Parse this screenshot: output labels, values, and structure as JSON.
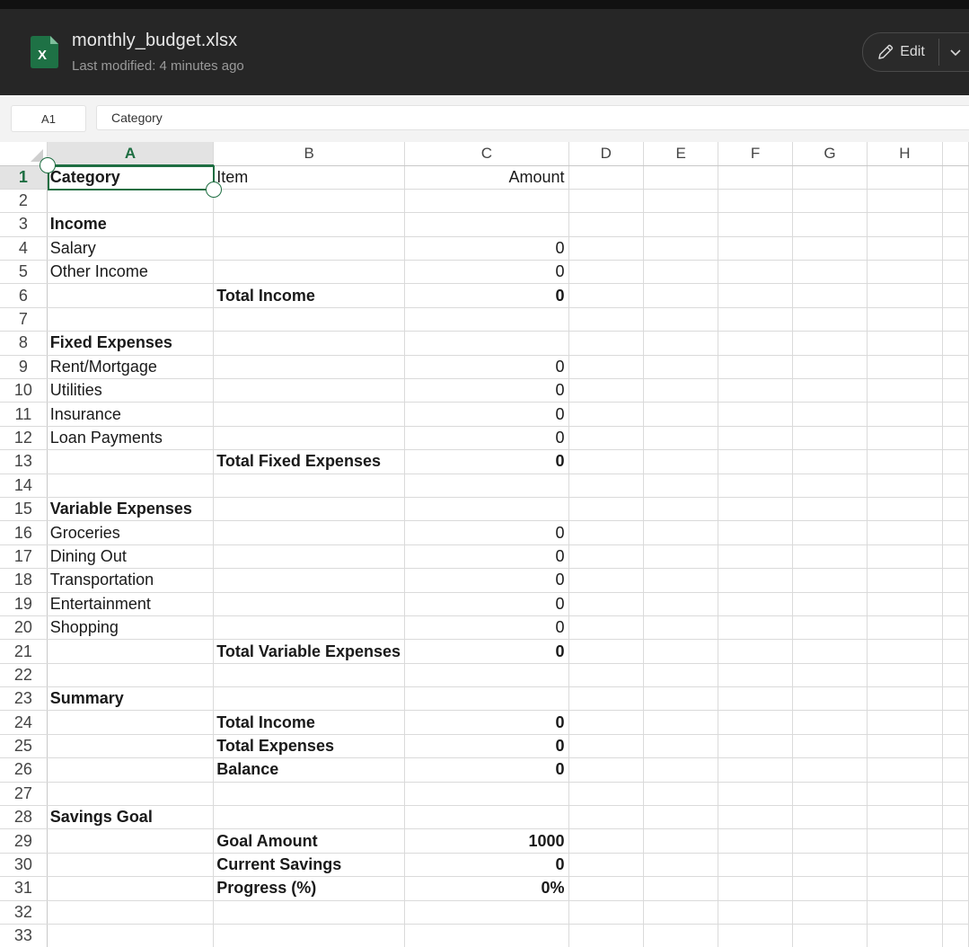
{
  "header": {
    "file_name": "monthly_budget.xlsx",
    "last_modified": "Last modified: 4 minutes ago",
    "edit_label": "Edit",
    "app_icon_letter": "X",
    "app_icon_color": "#1e7145"
  },
  "formula_bar": {
    "cell_ref": "A1",
    "content": "Category"
  },
  "columns": [
    "A",
    "B",
    "C",
    "D",
    "E",
    "F",
    "G",
    "H"
  ],
  "selected": {
    "cell": "A1",
    "color": "#1e6e42"
  },
  "rows": [
    {
      "n": "1",
      "a": "Category",
      "b": "Item",
      "c": "Amount",
      "a_bold": true
    },
    {
      "n": "2",
      "a": "",
      "b": "",
      "c": ""
    },
    {
      "n": "3",
      "a": "Income",
      "b": "",
      "c": "",
      "a_bold": true
    },
    {
      "n": "4",
      "a": "Salary",
      "b": "",
      "c": "0"
    },
    {
      "n": "5",
      "a": "Other Income",
      "b": "",
      "c": "0"
    },
    {
      "n": "6",
      "a": "",
      "b": "Total Income",
      "c": "0",
      "b_bold": true,
      "c_bold": true
    },
    {
      "n": "7",
      "a": "",
      "b": "",
      "c": ""
    },
    {
      "n": "8",
      "a": "Fixed Expenses",
      "b": "",
      "c": "",
      "a_bold": true
    },
    {
      "n": "9",
      "a": "Rent/Mortgage",
      "b": "",
      "c": "0"
    },
    {
      "n": "10",
      "a": "Utilities",
      "b": "",
      "c": "0"
    },
    {
      "n": "11",
      "a": "Insurance",
      "b": "",
      "c": "0"
    },
    {
      "n": "12",
      "a": "Loan Payments",
      "b": "",
      "c": "0"
    },
    {
      "n": "13",
      "a": "",
      "b": "Total Fixed Expenses",
      "c": "0",
      "b_bold": true,
      "c_bold": true
    },
    {
      "n": "14",
      "a": "",
      "b": "",
      "c": ""
    },
    {
      "n": "15",
      "a": "Variable Expenses",
      "b": "",
      "c": "",
      "a_bold": true
    },
    {
      "n": "16",
      "a": "Groceries",
      "b": "",
      "c": "0"
    },
    {
      "n": "17",
      "a": "Dining Out",
      "b": "",
      "c": "0"
    },
    {
      "n": "18",
      "a": "Transportation",
      "b": "",
      "c": "0"
    },
    {
      "n": "19",
      "a": "Entertainment",
      "b": "",
      "c": "0"
    },
    {
      "n": "20",
      "a": "Shopping",
      "b": "",
      "c": "0"
    },
    {
      "n": "21",
      "a": "",
      "b": "Total Variable Expenses",
      "c": "0",
      "b_bold": true,
      "c_bold": true
    },
    {
      "n": "22",
      "a": "",
      "b": "",
      "c": ""
    },
    {
      "n": "23",
      "a": "Summary",
      "b": "",
      "c": "",
      "a_bold": true
    },
    {
      "n": "24",
      "a": "",
      "b": "Total Income",
      "c": "0",
      "b_bold": true,
      "c_bold": true
    },
    {
      "n": "25",
      "a": "",
      "b": "Total Expenses",
      "c": "0",
      "b_bold": true,
      "c_bold": true
    },
    {
      "n": "26",
      "a": "",
      "b": "Balance",
      "c": "0",
      "b_bold": true,
      "c_bold": true
    },
    {
      "n": "27",
      "a": "",
      "b": "",
      "c": ""
    },
    {
      "n": "28",
      "a": "Savings Goal",
      "b": "",
      "c": "",
      "a_bold": true
    },
    {
      "n": "29",
      "a": "",
      "b": "Goal Amount",
      "c": "1000",
      "b_bold": true,
      "c_bold": true
    },
    {
      "n": "30",
      "a": "",
      "b": "Current Savings",
      "c": "0",
      "b_bold": true,
      "c_bold": true
    },
    {
      "n": "31",
      "a": "",
      "b": "Progress (%)",
      "c": "0%",
      "b_bold": true,
      "c_bold": true
    },
    {
      "n": "32",
      "a": "",
      "b": "",
      "c": ""
    },
    {
      "n": "33",
      "a": "",
      "b": "",
      "c": ""
    }
  ]
}
